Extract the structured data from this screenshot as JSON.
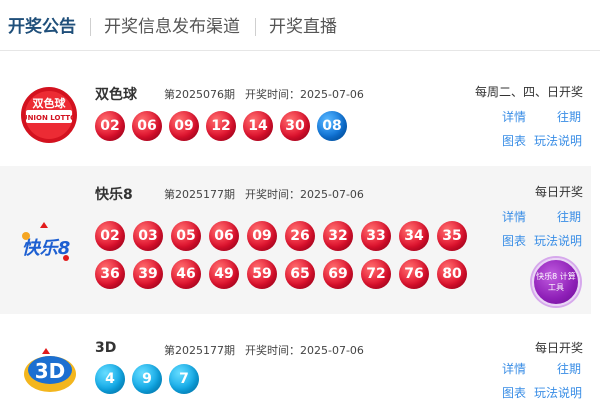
{
  "tabs": {
    "active": "开奖公告",
    "channels": "开奖信息发布渠道",
    "live": "开奖直播"
  },
  "lotteries": [
    {
      "name": "双色球",
      "issue": "第2025076期",
      "date": "开奖时间：2025-07-06",
      "schedule": "每周二、四、日开奖",
      "numbers": [
        "02",
        "06",
        "09",
        "12",
        "14",
        "30"
      ],
      "blue": "08",
      "links": {
        "detail": "详情",
        "history": "往期",
        "chart": "图表",
        "rules": "玩法说明"
      }
    },
    {
      "name": "快乐8",
      "issue": "第2025177期",
      "date": "开奖时间：2025-07-06",
      "schedule": "每日开奖",
      "numbers": [
        "02",
        "03",
        "05",
        "06",
        "09",
        "26",
        "32",
        "33",
        "34",
        "35",
        "36",
        "39",
        "46",
        "49",
        "59",
        "65",
        "69",
        "72",
        "76",
        "80"
      ],
      "links": {
        "detail": "详情",
        "history": "往期",
        "chart": "图表",
        "rules": "玩法说明"
      },
      "tool_badge": "快乐8 计算工具"
    },
    {
      "name": "3D",
      "issue": "第2025177期",
      "date": "开奖时间：2025-07-06",
      "schedule": "每日开奖",
      "numbers": [
        "4",
        "9",
        "7"
      ],
      "links": {
        "detail": "详情",
        "history": "往期",
        "chart": "图表",
        "rules": "玩法说明"
      }
    }
  ],
  "logos": {
    "ssq_text": "双色球",
    "ssq_sub": "UNION LOTTO",
    "kl8_text": "快乐8",
    "d3_text": "3D"
  },
  "colors": {
    "red_ball": "#e0102d",
    "blue_ball": "#0e72d6",
    "cyan_ball": "#0ea7e6",
    "link": "#3a8ee6",
    "tab_active": "#1f4f7a"
  }
}
